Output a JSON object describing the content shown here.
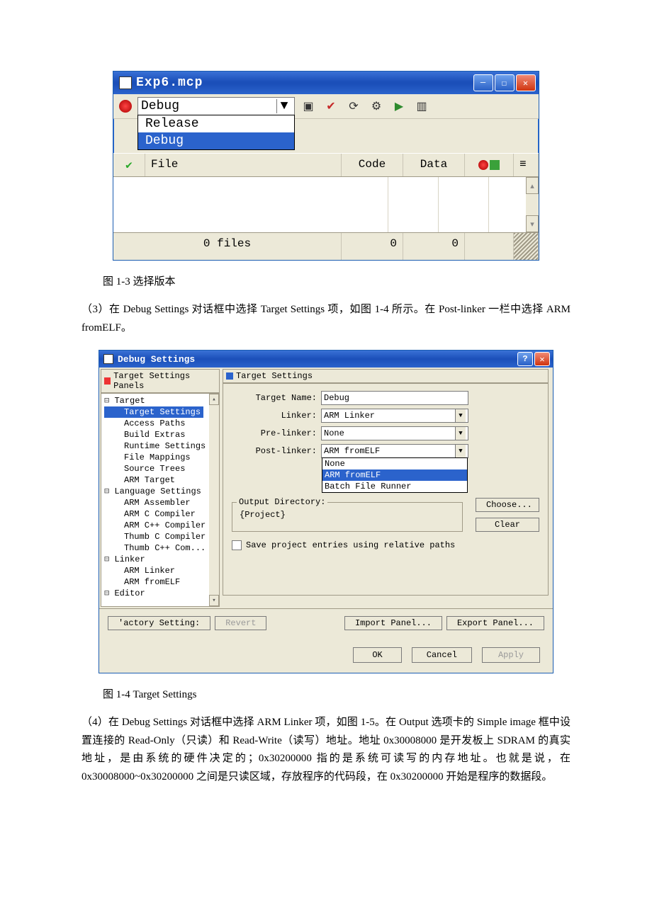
{
  "mcp_window": {
    "title": "Exp6.mcp",
    "build_select": {
      "current": "Debug",
      "options": [
        "Release",
        "Debug"
      ],
      "selected_option": "Debug"
    },
    "header": {
      "file": "File",
      "code": "Code",
      "data": "Data"
    },
    "footer": {
      "files": "0 files",
      "code": "0",
      "data": "0"
    }
  },
  "caption_1_3": "图 1-3 选择版本",
  "para_3": "（3）在 Debug Settings 对话框中选择 Target Settings 项，如图 1-4 所示。在 Post-linker 一栏中选择 ARM fromELF。",
  "debug_settings": {
    "title": "Debug Settings",
    "panels_title": "Target Settings Panels",
    "right_title": "Target Settings",
    "tree": {
      "groups": [
        {
          "label": "Target",
          "items": [
            "Target Settings",
            "Access Paths",
            "Build Extras",
            "Runtime Settings",
            "File Mappings",
            "Source Trees",
            "ARM Target"
          ],
          "selected": "Target Settings"
        },
        {
          "label": "Language Settings",
          "items": [
            "ARM Assembler",
            "ARM C Compiler",
            "ARM C++ Compiler",
            "Thumb C Compiler",
            "Thumb C++ Com..."
          ]
        },
        {
          "label": "Linker",
          "items": [
            "ARM Linker",
            "ARM fromELF"
          ]
        },
        {
          "label": "Editor",
          "items": []
        }
      ]
    },
    "form": {
      "target_name_label": "Target Name:",
      "target_name_value": "Debug",
      "linker_label": "Linker:",
      "linker_value": "ARM Linker",
      "prelinker_label": "Pre-linker:",
      "prelinker_value": "None",
      "postlinker_label": "Post-linker:",
      "postlinker_value": "ARM fromELF",
      "postlinker_options": [
        "None",
        "ARM fromELF",
        "Batch File Runner"
      ],
      "postlinker_selected_option": "ARM fromELF",
      "output_dir_legend": "Output Directory:",
      "output_dir_value": "{Project}",
      "choose_label": "Choose...",
      "clear_label": "Clear",
      "save_relative_label": "Save project entries using relative paths"
    },
    "panelbar": {
      "factory": "'actory Setting:",
      "revert": "Revert",
      "import": "Import Panel...",
      "export": "Export Panel..."
    },
    "bottom": {
      "ok": "OK",
      "cancel": "Cancel",
      "apply": "Apply"
    }
  },
  "caption_1_4": "图 1-4 Target Settings",
  "para_4": "（4）在 Debug Settings 对话框中选择 ARM Linker 项，如图 1-5。在 Output 选项卡的 Simple image 框中设置连接的 Read-Only（只读）和 Read-Write（读写）地址。地址 0x30008000 是开发板上 SDRAM 的真实地址，是由系统的硬件决定的；0x30200000 指的是系统可读写的内存地址。也就是说，在 0x30008000~0x30200000 之间是只读区域，存放程序的代码段，在 0x30200000 开始是程序的数据段。"
}
